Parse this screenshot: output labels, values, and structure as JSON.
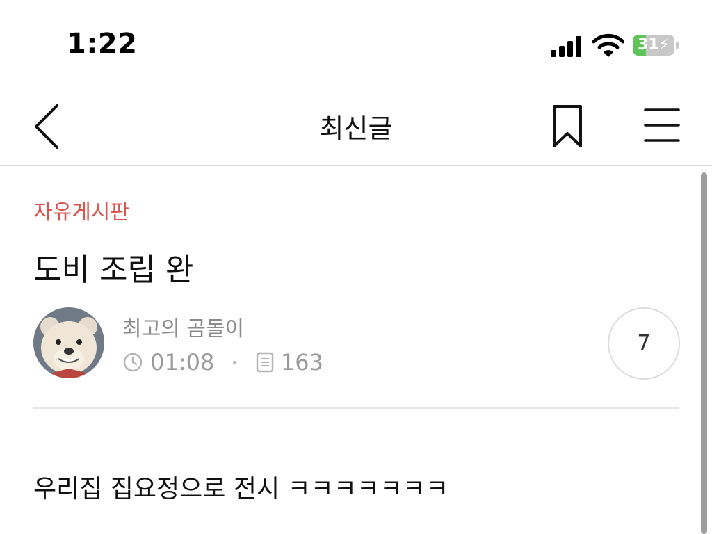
{
  "status_bar": {
    "time": "1:22",
    "battery_level": "31",
    "battery_charging": true,
    "signal_icon": "signal-bars-icon",
    "wifi_icon": "wifi-icon",
    "battery_icon": "battery-charging-icon"
  },
  "nav": {
    "title": "최신글",
    "back_icon": "chevron-left-icon",
    "bookmark_icon": "bookmark-icon",
    "menu_icon": "hamburger-menu-icon"
  },
  "post": {
    "board": "자유게시판",
    "title": "도비 조립 완",
    "author": "최고의 곰돌이",
    "time": "01:08",
    "views": "163",
    "comment_count": "7",
    "body": "우리집 집요정으로 전시 ㅋㅋㅋㅋㅋㅋㅋ"
  },
  "colors": {
    "board_accent": "#d9534f",
    "battery_fill": "#5ec35a",
    "meta_gray": "#9a9a9a"
  }
}
